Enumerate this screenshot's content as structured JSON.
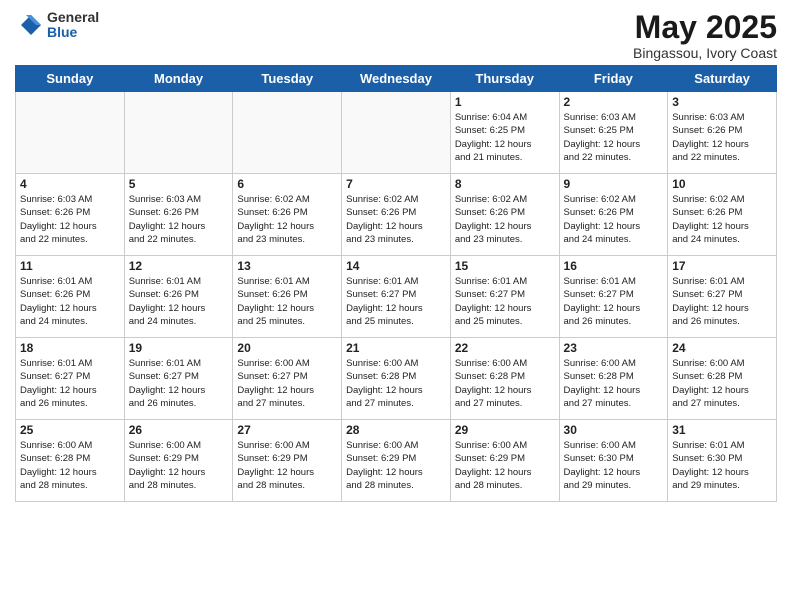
{
  "logo": {
    "general": "General",
    "blue": "Blue"
  },
  "title": {
    "month_year": "May 2025",
    "location": "Bingassou, Ivory Coast"
  },
  "days_of_week": [
    "Sunday",
    "Monday",
    "Tuesday",
    "Wednesday",
    "Thursday",
    "Friday",
    "Saturday"
  ],
  "weeks": [
    [
      {
        "day": "",
        "info": ""
      },
      {
        "day": "",
        "info": ""
      },
      {
        "day": "",
        "info": ""
      },
      {
        "day": "",
        "info": ""
      },
      {
        "day": "1",
        "info": "Sunrise: 6:04 AM\nSunset: 6:25 PM\nDaylight: 12 hours\nand 21 minutes."
      },
      {
        "day": "2",
        "info": "Sunrise: 6:03 AM\nSunset: 6:25 PM\nDaylight: 12 hours\nand 22 minutes."
      },
      {
        "day": "3",
        "info": "Sunrise: 6:03 AM\nSunset: 6:26 PM\nDaylight: 12 hours\nand 22 minutes."
      }
    ],
    [
      {
        "day": "4",
        "info": "Sunrise: 6:03 AM\nSunset: 6:26 PM\nDaylight: 12 hours\nand 22 minutes."
      },
      {
        "day": "5",
        "info": "Sunrise: 6:03 AM\nSunset: 6:26 PM\nDaylight: 12 hours\nand 22 minutes."
      },
      {
        "day": "6",
        "info": "Sunrise: 6:02 AM\nSunset: 6:26 PM\nDaylight: 12 hours\nand 23 minutes."
      },
      {
        "day": "7",
        "info": "Sunrise: 6:02 AM\nSunset: 6:26 PM\nDaylight: 12 hours\nand 23 minutes."
      },
      {
        "day": "8",
        "info": "Sunrise: 6:02 AM\nSunset: 6:26 PM\nDaylight: 12 hours\nand 23 minutes."
      },
      {
        "day": "9",
        "info": "Sunrise: 6:02 AM\nSunset: 6:26 PM\nDaylight: 12 hours\nand 24 minutes."
      },
      {
        "day": "10",
        "info": "Sunrise: 6:02 AM\nSunset: 6:26 PM\nDaylight: 12 hours\nand 24 minutes."
      }
    ],
    [
      {
        "day": "11",
        "info": "Sunrise: 6:01 AM\nSunset: 6:26 PM\nDaylight: 12 hours\nand 24 minutes."
      },
      {
        "day": "12",
        "info": "Sunrise: 6:01 AM\nSunset: 6:26 PM\nDaylight: 12 hours\nand 24 minutes."
      },
      {
        "day": "13",
        "info": "Sunrise: 6:01 AM\nSunset: 6:26 PM\nDaylight: 12 hours\nand 25 minutes."
      },
      {
        "day": "14",
        "info": "Sunrise: 6:01 AM\nSunset: 6:27 PM\nDaylight: 12 hours\nand 25 minutes."
      },
      {
        "day": "15",
        "info": "Sunrise: 6:01 AM\nSunset: 6:27 PM\nDaylight: 12 hours\nand 25 minutes."
      },
      {
        "day": "16",
        "info": "Sunrise: 6:01 AM\nSunset: 6:27 PM\nDaylight: 12 hours\nand 26 minutes."
      },
      {
        "day": "17",
        "info": "Sunrise: 6:01 AM\nSunset: 6:27 PM\nDaylight: 12 hours\nand 26 minutes."
      }
    ],
    [
      {
        "day": "18",
        "info": "Sunrise: 6:01 AM\nSunset: 6:27 PM\nDaylight: 12 hours\nand 26 minutes."
      },
      {
        "day": "19",
        "info": "Sunrise: 6:01 AM\nSunset: 6:27 PM\nDaylight: 12 hours\nand 26 minutes."
      },
      {
        "day": "20",
        "info": "Sunrise: 6:00 AM\nSunset: 6:27 PM\nDaylight: 12 hours\nand 27 minutes."
      },
      {
        "day": "21",
        "info": "Sunrise: 6:00 AM\nSunset: 6:28 PM\nDaylight: 12 hours\nand 27 minutes."
      },
      {
        "day": "22",
        "info": "Sunrise: 6:00 AM\nSunset: 6:28 PM\nDaylight: 12 hours\nand 27 minutes."
      },
      {
        "day": "23",
        "info": "Sunrise: 6:00 AM\nSunset: 6:28 PM\nDaylight: 12 hours\nand 27 minutes."
      },
      {
        "day": "24",
        "info": "Sunrise: 6:00 AM\nSunset: 6:28 PM\nDaylight: 12 hours\nand 27 minutes."
      }
    ],
    [
      {
        "day": "25",
        "info": "Sunrise: 6:00 AM\nSunset: 6:28 PM\nDaylight: 12 hours\nand 28 minutes."
      },
      {
        "day": "26",
        "info": "Sunrise: 6:00 AM\nSunset: 6:29 PM\nDaylight: 12 hours\nand 28 minutes."
      },
      {
        "day": "27",
        "info": "Sunrise: 6:00 AM\nSunset: 6:29 PM\nDaylight: 12 hours\nand 28 minutes."
      },
      {
        "day": "28",
        "info": "Sunrise: 6:00 AM\nSunset: 6:29 PM\nDaylight: 12 hours\nand 28 minutes."
      },
      {
        "day": "29",
        "info": "Sunrise: 6:00 AM\nSunset: 6:29 PM\nDaylight: 12 hours\nand 28 minutes."
      },
      {
        "day": "30",
        "info": "Sunrise: 6:00 AM\nSunset: 6:30 PM\nDaylight: 12 hours\nand 29 minutes."
      },
      {
        "day": "31",
        "info": "Sunrise: 6:01 AM\nSunset: 6:30 PM\nDaylight: 12 hours\nand 29 minutes."
      }
    ]
  ]
}
